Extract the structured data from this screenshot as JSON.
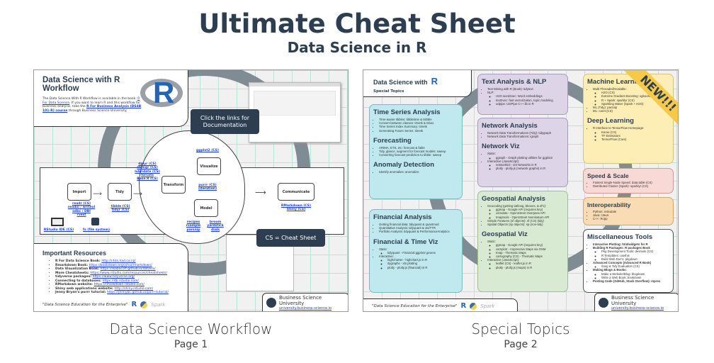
{
  "title": "Ultimate Cheat Sheet",
  "subtitle": "Data Science in R",
  "page1": {
    "caption": "Data Science Workflow",
    "page": "Page 1",
    "header_title": "Data Science with R Workflow",
    "header_text": "The Data Science With R Workflow is available in the book: ",
    "header_link1": "R For Data Science",
    "header_text2": ". If you want to learn R and this workflow for business analysis, take the ",
    "header_link2": "R For Business Analysis (DS4B 101-R) course",
    "header_text3": " through Business Science University.",
    "callout_docs": "Click the links for Documentation",
    "callout_cs": "CS = Cheat Sheet",
    "nodes": {
      "import": "Import",
      "tidy": "Tidy",
      "transform": "Transform",
      "visualize": "Visualize",
      "model": "Model",
      "communicate": "Communicate"
    },
    "pkgs": {
      "import": "readr (CS)\nreadxl / writexl\nodbc / DBI\nrvest",
      "tidy": "tibble (CS)\ntidyr (CS)",
      "transform": "dplyr (CS)\nstringr (CS)\nlubridate (CS)\nforcats\nBase R (CS)",
      "visualize": "ggplot2 (CS)",
      "iteration": "purrr (CS)\n(iteration)",
      "model_left": "recipes\nrsample\nparsnip",
      "model_right": "broom\nyardstick\ndials",
      "communicate": "RMarkdown (CS)\nShiny (CS)",
      "rstudio": "RStudio IDE (CS)",
      "fs": "fs (file system)"
    },
    "resources_title": "Important Resources",
    "resources": [
      {
        "label": "R For Data Science Book:",
        "link": "http://r4ds.had.co.nz/"
      },
      {
        "label": "Rmarkdown Book:",
        "link": "https://bookdown.org/yihui/rmarkdown/"
      },
      {
        "label": "Data Visualization Book:",
        "link": "https://rkabacoff.github.io/datavis/"
      },
      {
        "label": "More Cheatsheets:",
        "link": "https://www.rstudio.com/resources/cheatsheets/"
      },
      {
        "label": "tidyverse packages:",
        "link": "https://www.tidyverse.org/"
      },
      {
        "label": "Connecting to databases:",
        "link": "https://db.rstudio.com/"
      },
      {
        "label": "RMarkdown website:",
        "link": "https://rmarkdown.rstudio.com/"
      },
      {
        "label": "Shiny web applications website:",
        "link": "http://shiny.rstudio.com/"
      },
      {
        "label": "Jenny Bryan's purrr tutorial:",
        "link": "https://jennybc.github.io/purrr-tutorial/"
      }
    ],
    "tagline": "\"Data Science Education for the Enterprise\"",
    "bsu_name": "Business Science University",
    "bsu_url": "university.business-science.io"
  },
  "page2": {
    "caption": "Special Topics",
    "page": "Page 2",
    "header_title": "Data Science with",
    "header_sub": "Special Topics",
    "ribbon": "NEW!!!",
    "tagline": "\"Data Science Education for the Enterprise\"",
    "bsu_name": "Business Science University",
    "bsu_url": "university.business-science.io",
    "sections": {
      "ts": {
        "title": "Time Series Analysis",
        "items": [
          "Time-aware tibbles: tibbletime & tsibble",
          "Convert between classes: timetk & tsbox",
          "Time Series Index Summary: timetk",
          "Generating Future Series: timetk"
        ]
      },
      "fc": {
        "title": "Forecasting",
        "items": [
          "ARIMA, ETS, etc: forecast & fable",
          "Tidy, glance, augment for forecast models: sweep",
          "Converting forecast prediction to tibble: sweep"
        ]
      },
      "ad": {
        "title": "Anomaly Detection",
        "items": [
          "Identify anomalies: anomalize"
        ]
      },
      "fa": {
        "title": "Financial Analysis",
        "items": [
          "Getting financial data: tidyquant & quantmod",
          "Quantitative Analysis: tidyquant & xts/TTR",
          "Portfolio Analysis: tidyquant & PerformanceAnalytics"
        ]
      },
      "fv": {
        "title": "Financial & Time Viz",
        "items": [
          "Static:",
          "tidyquant - Financial ggplot2 geoms",
          "Interactive:",
          "highcharter - highchart.js in R",
          "dygraphs - xts plotting",
          "plotly - plotly.js (financial) in R"
        ]
      },
      "nlp": {
        "title": "Text Analysis & NLP",
        "items": [
          "Text Mining with R (Book): tidytext",
          "NLP:",
          "H2O word2vec: Word embeddings",
          "text2vec: fast vectorization, topic modeling",
          "udpipe: UDPipe C++ lib in R"
        ]
      },
      "na": {
        "title": "Network Analysis",
        "items": [
          "Network Data Transformations (Tidy): tidygraph",
          "Network Data Transformations: igraph"
        ]
      },
      "nv": {
        "title": "Network Viz",
        "items": [
          "Static:",
          "ggraph - Graph plotting utilities for ggplot2",
          "Interactive (JavaScript):",
          "networkD3 - D3 Networks in R",
          "plotly - plotly.js (network graphs) in R"
        ]
      },
      "ga": {
        "title": "Geospatial Analysis",
        "items": [
          "Geocoding (getting lat/long, bboxes, & sf's):",
          "ggmap - Google API (requires key)",
          "osmdata - OpenStreet Overpass API",
          "tmaptools - OpenStreet Nominatum API",
          "Simple Features (sf objects): sf (CS) (tidy)",
          "Spatial Objects (sp objects): sp (non-tidy)"
        ]
      },
      "gv": {
        "title": "Geospatial Viz",
        "items": [
          "Static:",
          "ggmap - Google API (requires key)",
          "osmplotr - Impressive Maps via OSM",
          "tmap - Thematic Maps",
          "cartography (CS) - Thematic Maps",
          "Interactive (JavaScript):",
          "leaflet (CS) - leaflet.js in R",
          "plotly - plotly.js (maps) in R"
        ]
      },
      "ml": {
        "title": "Machine Learning",
        "items": [
          "Multi-Threaded/Scalable:",
          "H2O (CS)",
          "Extreme Gradient Boosting: xgboost",
          "R + Spark: sparklyr (CS)",
          "Sparkling Water (Spark + H2O)",
          "ML (Tidy): parsnip",
          "ML: caret (CS)"
        ]
      },
      "dl": {
        "title": "Deep Learning",
        "items": [
          "R Interface to TensorFlow Homepage:",
          "Keras (CS)",
          "TF Estimators",
          "TensorFlow (Core)"
        ]
      },
      "ss": {
        "title": "Speed & Scale",
        "items": [
          "Fastest Single-Node Speed: data.table (CS)",
          "Distributed Cluster (Spark): sparklyr (CS)"
        ]
      },
      "io": {
        "title": "Interoperability",
        "items": [
          "Python: reticulate",
          "Java: rJava",
          "C++: Rcpp"
        ]
      },
      "misc": {
        "title": "Miscellaneous Tools",
        "items": [
          "Interactive Plotting: htmlwidgets for R",
          "Building R Packages: R packages Book",
          "Pkg Development Tools: devtools (CS)",
          "R Templates: usethis",
          "Build Web Doc's: pkgdown",
          "Advanced Concepts (Advanced R Book)",
          "rlang & Tidy Evaluation (CS)",
          "Making Blogs & Books:",
          "Make a Website/Blog: blogdown",
          "Write a Web Book: bookdown",
          "Posting Code (GitHub, Stack Overflow): reprex"
        ]
      }
    }
  },
  "colors": {
    "dark": "#2c3e50",
    "link": "#1a3edb",
    "cyan": "#bfe9ef",
    "purple": "#ddd4e8",
    "green": "#d8ead2",
    "yellow": "#fdeeb5",
    "pink": "#f8d9d6",
    "orange": "#f9dcb4",
    "ribbon": "#f7c948"
  }
}
